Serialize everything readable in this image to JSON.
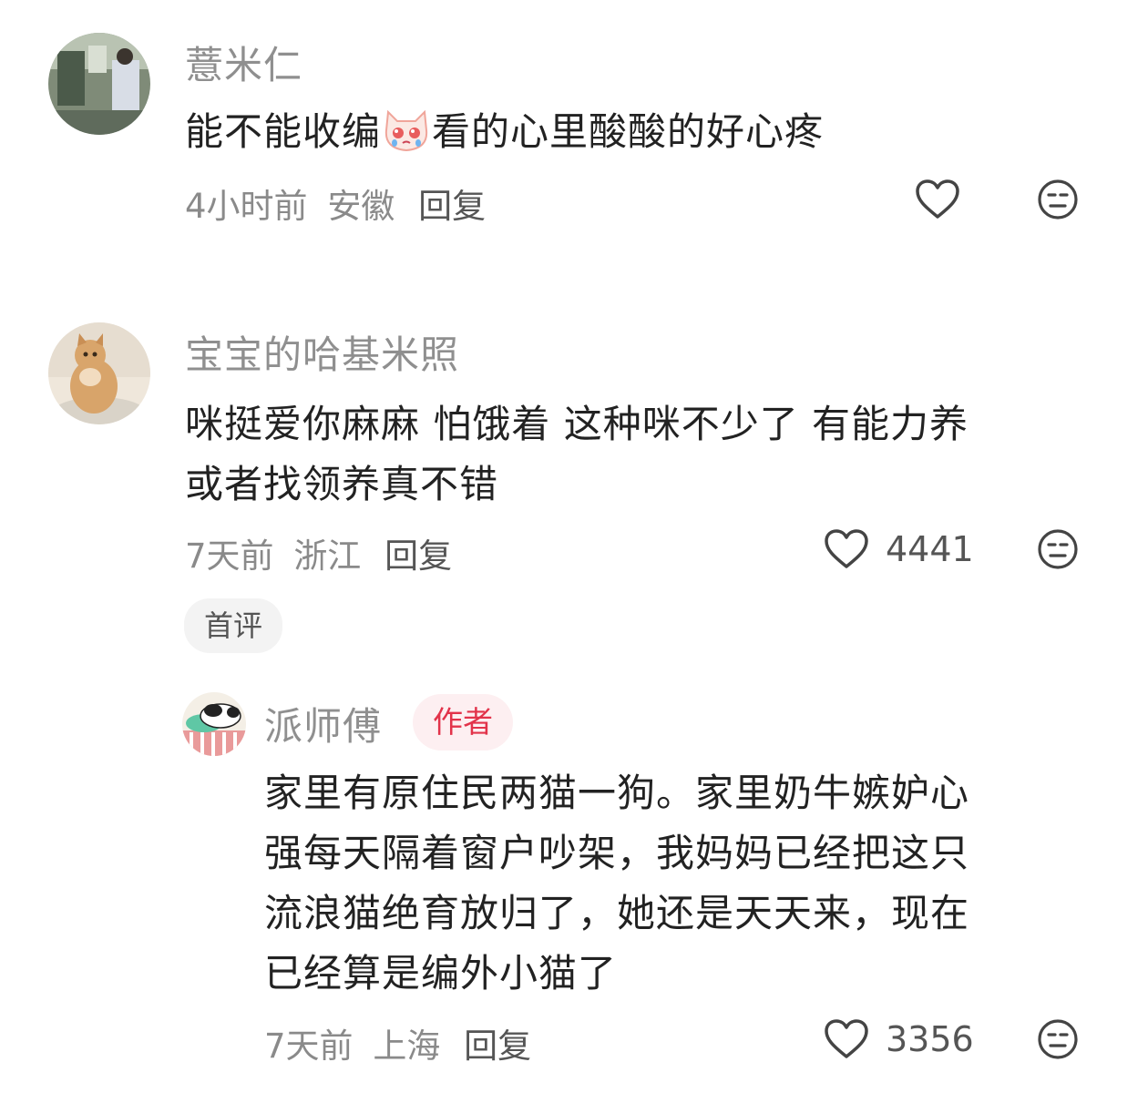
{
  "comments": [
    {
      "username": "薏米仁",
      "text_before_emoji": "能不能收编",
      "emoji": "crying-cat-emoji",
      "text_after_emoji": "看的心里酸酸的好心疼",
      "time": "4小时前",
      "location": "安徽",
      "reply_label": "回复",
      "like_count": ""
    },
    {
      "username": "宝宝的哈基米照",
      "text_line1": "咪挺爱你麻麻 怕饿着 这种咪不少了 有能力养",
      "text_line2": "或者找领养真不错",
      "time": "7天前",
      "location": "浙江",
      "reply_label": "回复",
      "like_count": "4441",
      "badge": "首评"
    }
  ],
  "reply": {
    "username": "派师傅",
    "author_badge": "作者",
    "lines": [
      "家里有原住民两猫一狗。家里奶牛嫉妒心",
      "强每天隔着窗户吵架，我妈妈已经把这只",
      "流浪猫绝育放归了，她还是天天来，现在",
      "已经算是编外小猫了"
    ],
    "time": "7天前",
    "location": "上海",
    "reply_label": "回复",
    "like_count": "3356"
  },
  "icons": {
    "like": "heart-outline-icon",
    "dislike": "neutral-face-icon"
  },
  "colors": {
    "username": "#8f8f8f",
    "author_badge_text": "#e2334a",
    "author_badge_bg": "#fdeff1"
  }
}
